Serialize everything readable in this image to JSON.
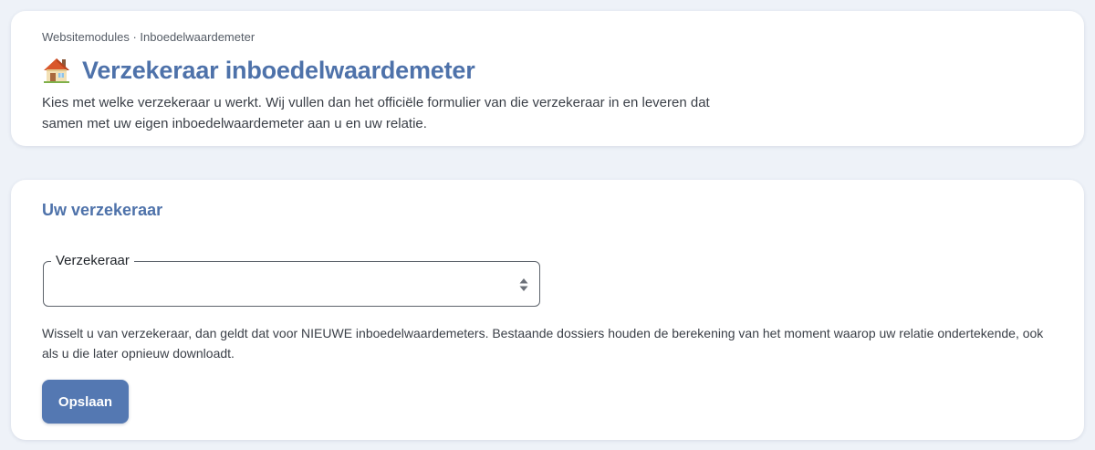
{
  "breadcrumb": "Websitemodules · Inboedelwaardemeter",
  "header": {
    "title": "Verzekeraar inboedelwaardemeter",
    "icon": "house-icon",
    "intro": "Kies met welke verzekeraar u werkt. Wij vullen dan het officiële formulier van die verzekeraar in en leveren dat samen met uw eigen inboedelwaardemeter aan u en uw relatie."
  },
  "form": {
    "section_title": "Uw verzekeraar",
    "field_label": "Verzekeraar",
    "field_value": "",
    "help_text": "Wisselt u van verzekeraar, dan geldt dat voor NIEUWE inboedelwaardemeters. Bestaande dossiers houden de berekening van het moment waarop uw relatie ondertekende, ook als u die later opnieuw downloadt.",
    "save_label": "Opslaan"
  },
  "colors": {
    "accent": "#4e72aa",
    "button": "#5478b2",
    "background": "#eef2f8"
  }
}
